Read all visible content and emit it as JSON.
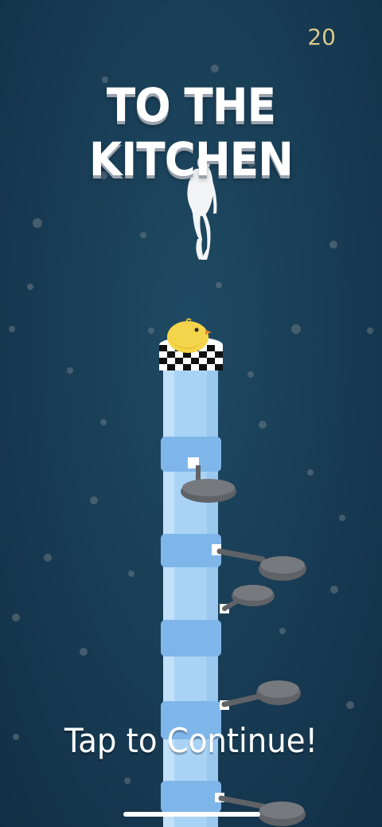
{
  "hud": {
    "score": "20"
  },
  "level": {
    "title": "TO THE KITCHEN"
  },
  "prompt": {
    "continue_text": "Tap to Continue!"
  },
  "colors": {
    "background": "#173a52",
    "tower": "#a9d3f5",
    "tower_band": "#7fb6ea",
    "pan": "#5f6266",
    "chick": "#f4d44a",
    "score": "#d8c98a"
  }
}
